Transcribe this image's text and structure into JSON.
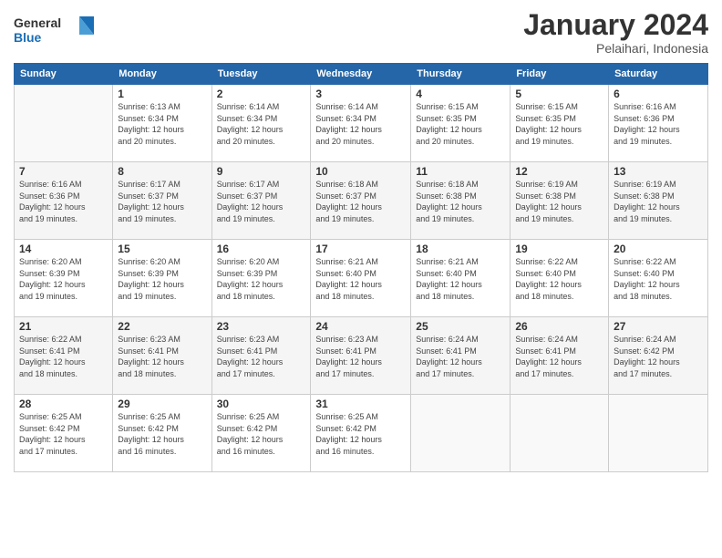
{
  "header": {
    "logo_general": "General",
    "logo_blue": "Blue",
    "title": "January 2024",
    "subtitle": "Pelaihari, Indonesia"
  },
  "weekdays": [
    "Sunday",
    "Monday",
    "Tuesday",
    "Wednesday",
    "Thursday",
    "Friday",
    "Saturday"
  ],
  "weeks": [
    [
      {
        "day": "",
        "info": ""
      },
      {
        "day": "1",
        "info": "Sunrise: 6:13 AM\nSunset: 6:34 PM\nDaylight: 12 hours\nand 20 minutes."
      },
      {
        "day": "2",
        "info": "Sunrise: 6:14 AM\nSunset: 6:34 PM\nDaylight: 12 hours\nand 20 minutes."
      },
      {
        "day": "3",
        "info": "Sunrise: 6:14 AM\nSunset: 6:34 PM\nDaylight: 12 hours\nand 20 minutes."
      },
      {
        "day": "4",
        "info": "Sunrise: 6:15 AM\nSunset: 6:35 PM\nDaylight: 12 hours\nand 20 minutes."
      },
      {
        "day": "5",
        "info": "Sunrise: 6:15 AM\nSunset: 6:35 PM\nDaylight: 12 hours\nand 19 minutes."
      },
      {
        "day": "6",
        "info": "Sunrise: 6:16 AM\nSunset: 6:36 PM\nDaylight: 12 hours\nand 19 minutes."
      }
    ],
    [
      {
        "day": "7",
        "info": "Sunrise: 6:16 AM\nSunset: 6:36 PM\nDaylight: 12 hours\nand 19 minutes."
      },
      {
        "day": "8",
        "info": "Sunrise: 6:17 AM\nSunset: 6:37 PM\nDaylight: 12 hours\nand 19 minutes."
      },
      {
        "day": "9",
        "info": "Sunrise: 6:17 AM\nSunset: 6:37 PM\nDaylight: 12 hours\nand 19 minutes."
      },
      {
        "day": "10",
        "info": "Sunrise: 6:18 AM\nSunset: 6:37 PM\nDaylight: 12 hours\nand 19 minutes."
      },
      {
        "day": "11",
        "info": "Sunrise: 6:18 AM\nSunset: 6:38 PM\nDaylight: 12 hours\nand 19 minutes."
      },
      {
        "day": "12",
        "info": "Sunrise: 6:19 AM\nSunset: 6:38 PM\nDaylight: 12 hours\nand 19 minutes."
      },
      {
        "day": "13",
        "info": "Sunrise: 6:19 AM\nSunset: 6:38 PM\nDaylight: 12 hours\nand 19 minutes."
      }
    ],
    [
      {
        "day": "14",
        "info": "Sunrise: 6:20 AM\nSunset: 6:39 PM\nDaylight: 12 hours\nand 19 minutes."
      },
      {
        "day": "15",
        "info": "Sunrise: 6:20 AM\nSunset: 6:39 PM\nDaylight: 12 hours\nand 19 minutes."
      },
      {
        "day": "16",
        "info": "Sunrise: 6:20 AM\nSunset: 6:39 PM\nDaylight: 12 hours\nand 18 minutes."
      },
      {
        "day": "17",
        "info": "Sunrise: 6:21 AM\nSunset: 6:40 PM\nDaylight: 12 hours\nand 18 minutes."
      },
      {
        "day": "18",
        "info": "Sunrise: 6:21 AM\nSunset: 6:40 PM\nDaylight: 12 hours\nand 18 minutes."
      },
      {
        "day": "19",
        "info": "Sunrise: 6:22 AM\nSunset: 6:40 PM\nDaylight: 12 hours\nand 18 minutes."
      },
      {
        "day": "20",
        "info": "Sunrise: 6:22 AM\nSunset: 6:40 PM\nDaylight: 12 hours\nand 18 minutes."
      }
    ],
    [
      {
        "day": "21",
        "info": "Sunrise: 6:22 AM\nSunset: 6:41 PM\nDaylight: 12 hours\nand 18 minutes."
      },
      {
        "day": "22",
        "info": "Sunrise: 6:23 AM\nSunset: 6:41 PM\nDaylight: 12 hours\nand 18 minutes."
      },
      {
        "day": "23",
        "info": "Sunrise: 6:23 AM\nSunset: 6:41 PM\nDaylight: 12 hours\nand 17 minutes."
      },
      {
        "day": "24",
        "info": "Sunrise: 6:23 AM\nSunset: 6:41 PM\nDaylight: 12 hours\nand 17 minutes."
      },
      {
        "day": "25",
        "info": "Sunrise: 6:24 AM\nSunset: 6:41 PM\nDaylight: 12 hours\nand 17 minutes."
      },
      {
        "day": "26",
        "info": "Sunrise: 6:24 AM\nSunset: 6:41 PM\nDaylight: 12 hours\nand 17 minutes."
      },
      {
        "day": "27",
        "info": "Sunrise: 6:24 AM\nSunset: 6:42 PM\nDaylight: 12 hours\nand 17 minutes."
      }
    ],
    [
      {
        "day": "28",
        "info": "Sunrise: 6:25 AM\nSunset: 6:42 PM\nDaylight: 12 hours\nand 17 minutes."
      },
      {
        "day": "29",
        "info": "Sunrise: 6:25 AM\nSunset: 6:42 PM\nDaylight: 12 hours\nand 16 minutes."
      },
      {
        "day": "30",
        "info": "Sunrise: 6:25 AM\nSunset: 6:42 PM\nDaylight: 12 hours\nand 16 minutes."
      },
      {
        "day": "31",
        "info": "Sunrise: 6:25 AM\nSunset: 6:42 PM\nDaylight: 12 hours\nand 16 minutes."
      },
      {
        "day": "",
        "info": ""
      },
      {
        "day": "",
        "info": ""
      },
      {
        "day": "",
        "info": ""
      }
    ]
  ]
}
